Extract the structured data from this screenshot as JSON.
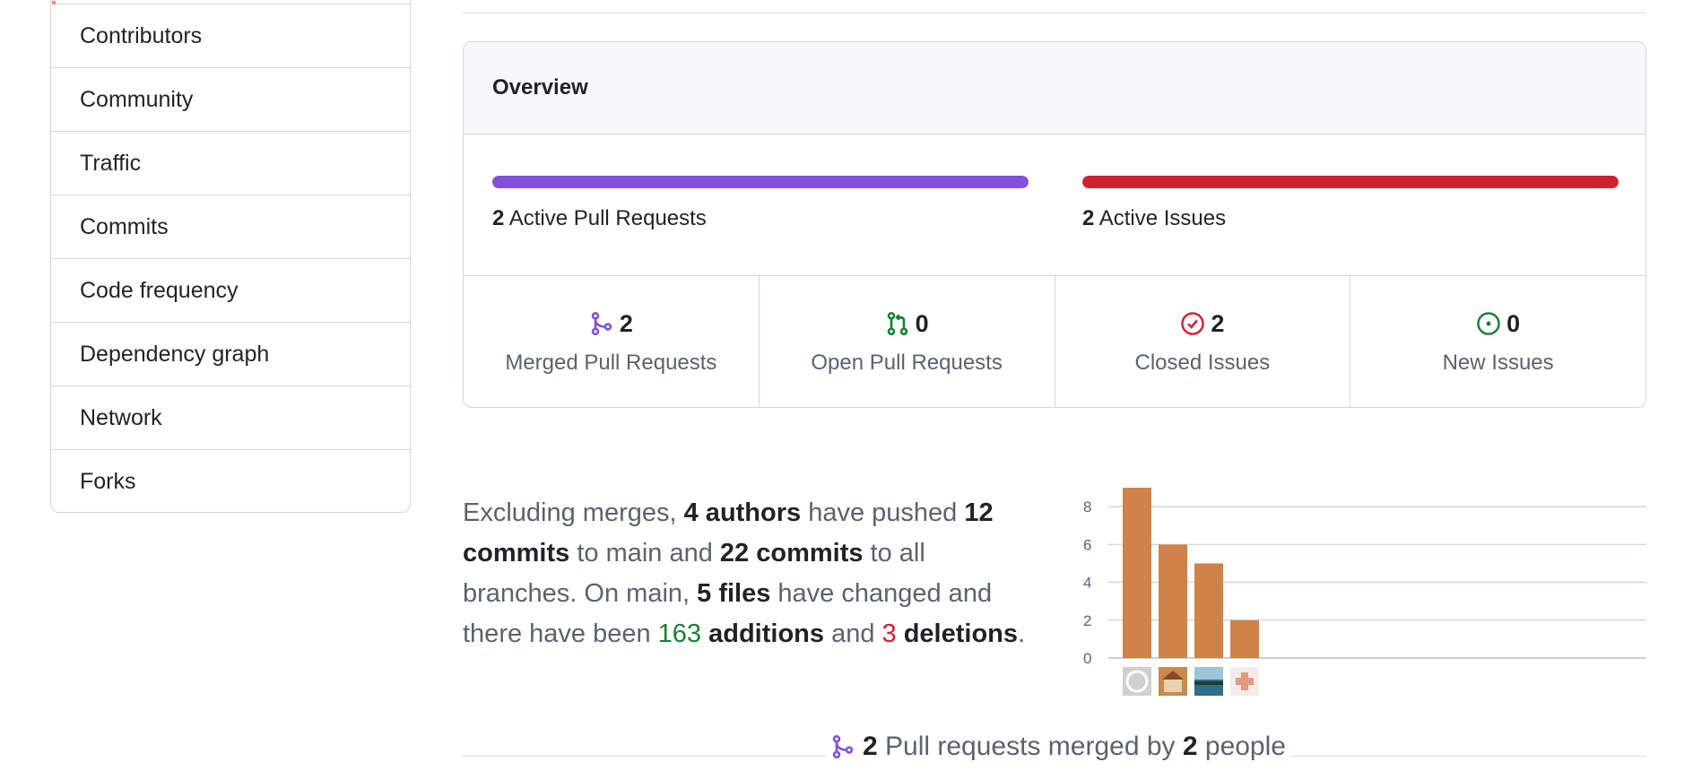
{
  "sidebar": {
    "items": [
      {
        "label": "Contributors"
      },
      {
        "label": "Community"
      },
      {
        "label": "Traffic"
      },
      {
        "label": "Commits"
      },
      {
        "label": "Code frequency"
      },
      {
        "label": "Dependency graph"
      },
      {
        "label": "Network"
      },
      {
        "label": "Forks"
      }
    ]
  },
  "overview": {
    "title": "Overview",
    "active_prs": {
      "count": "2",
      "label": "Active Pull Requests",
      "color": "#8250df",
      "fill": 1.0
    },
    "active_issues": {
      "count": "2",
      "label": "Active Issues",
      "color": "#cf222e",
      "fill": 1.0
    },
    "stats": [
      {
        "icon": "git-merge-icon",
        "count": "2",
        "label": "Merged Pull Requests",
        "color": "#8250df"
      },
      {
        "icon": "git-pull-request-icon",
        "count": "0",
        "label": "Open Pull Requests",
        "color": "#1a7f37"
      },
      {
        "icon": "issue-closed-icon",
        "count": "2",
        "label": "Closed Issues",
        "color": "#cf222e"
      },
      {
        "icon": "issue-opened-icon",
        "count": "0",
        "label": "New Issues",
        "color": "#1a7f37"
      }
    ]
  },
  "summary": {
    "p1": "Excluding merges, ",
    "authors": "4 authors",
    "p2": " have pushed ",
    "commits_main": "12 commits",
    "p3": " to main and ",
    "commits_all": "22 commits",
    "p4": " to all branches. On main, ",
    "files": "5 files",
    "p5": " have changed and there have been ",
    "additions_num": "163",
    "additions_word": " additions",
    "p6": " and ",
    "deletions_num": "3",
    "deletions_word": " deletions",
    "p7": "."
  },
  "chart_data": {
    "type": "bar",
    "categories": [
      "author-1",
      "author-2",
      "author-3",
      "author-4"
    ],
    "values": [
      9,
      6,
      5,
      2
    ],
    "ylim": [
      0,
      9
    ],
    "yticks": [
      0,
      2,
      4,
      6,
      8
    ],
    "bar_color": "#d08349",
    "grid": true,
    "avatars": [
      "github-default-avatar",
      "house-photo-avatar",
      "lake-photo-avatar",
      "identicon-avatar"
    ]
  },
  "merged_summary": {
    "count": "2",
    "text": " Pull requests merged by ",
    "people_count": "2",
    "people_text": " people"
  }
}
